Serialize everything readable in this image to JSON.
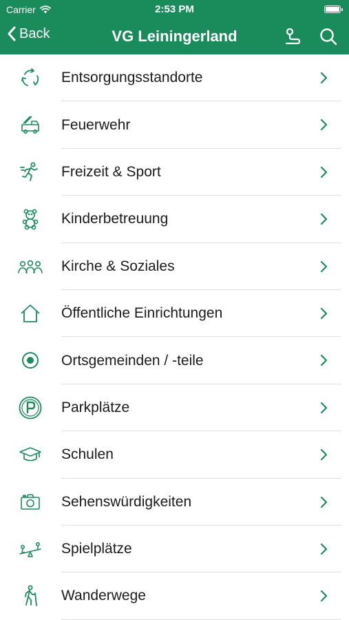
{
  "status": {
    "carrier": "Carrier",
    "time": "2:53 PM"
  },
  "nav": {
    "back_label": "Back",
    "title": "VG Leiningerland"
  },
  "theme": {
    "accent": "#1a8c5c"
  },
  "items": [
    {
      "label": "Entsorgungsstandorte",
      "icon": "recycle-icon"
    },
    {
      "label": "Feuerwehr",
      "icon": "fire-truck-icon"
    },
    {
      "label": "Freizeit & Sport",
      "icon": "runner-icon"
    },
    {
      "label": "Kinderbetreuung",
      "icon": "teddy-bear-icon"
    },
    {
      "label": "Kirche & Soziales",
      "icon": "people-group-icon"
    },
    {
      "label": "Öffentliche Einrichtungen",
      "icon": "house-icon"
    },
    {
      "label": "Ortsgemeinden / -teile",
      "icon": "location-dot-icon"
    },
    {
      "label": "Parkplätze",
      "icon": "parking-icon"
    },
    {
      "label": "Schulen",
      "icon": "graduation-cap-icon"
    },
    {
      "label": "Sehenswürdigkeiten",
      "icon": "camera-icon"
    },
    {
      "label": "Spielplätze",
      "icon": "seesaw-icon"
    },
    {
      "label": "Wanderwege",
      "icon": "hiker-icon"
    }
  ]
}
